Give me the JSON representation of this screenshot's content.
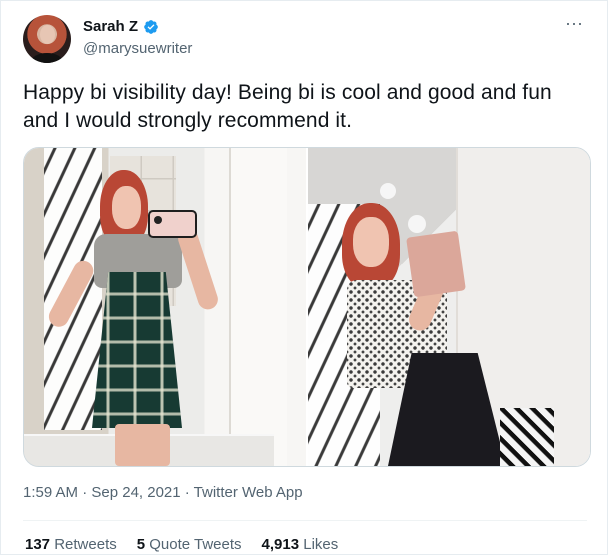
{
  "tweet": {
    "author": {
      "name": "Sarah Z",
      "handle": "@marysuewriter",
      "verified": true
    },
    "text": "Happy bi visibility day! Being bi is cool and good and fun and I would strongly recommend it.",
    "timestamp": "1:59 AM · Sep 24, 2021 · Twitter Web App",
    "stats": [
      {
        "value": "137",
        "label": "Retweets"
      },
      {
        "value": "5",
        "label": "Quote Tweets"
      },
      {
        "value": "4,913",
        "label": "Likes"
      }
    ]
  },
  "colors": {
    "accent": "#1d9bf0",
    "secondary_text": "#536471",
    "border": "#cfd9de"
  },
  "icons": {
    "verified": "verified-badge-icon",
    "more": "more-horizontal-icon"
  }
}
